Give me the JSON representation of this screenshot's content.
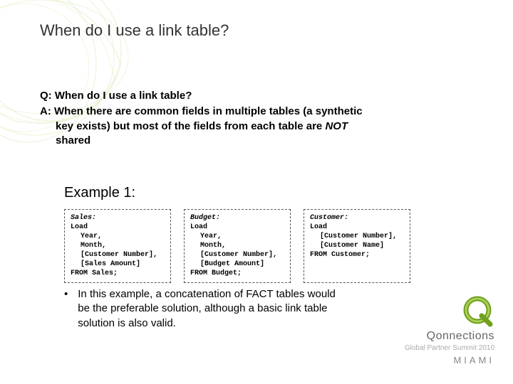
{
  "title": "When do I use a link table?",
  "qa": {
    "q": "Q: When do I use a link table?",
    "a_line1": "A: When there are common fields in multiple tables (a synthetic",
    "a_line2": "key exists) but most of the fields from each table are ",
    "a_not": "NOT",
    "a_line3": "shared"
  },
  "example_label": "Example 1:",
  "code": {
    "sales": {
      "name": "Sales:",
      "l1": "Load",
      "f1": "Year,",
      "f2": "Month,",
      "f3": "[Customer Number],",
      "f4": "[Sales Amount]",
      "from": "FROM Sales;"
    },
    "budget": {
      "name": "Budget:",
      "l1": "Load",
      "f1": "Year,",
      "f2": "Month,",
      "f3": "[Customer Number],",
      "f4": "[Budget Amount]",
      "from": "FROM Budget;"
    },
    "customer": {
      "name": "Customer:",
      "l1": "Load",
      "f1": "[Customer Number],",
      "f2": "[Customer Name]",
      "from": "FROM Customer;"
    }
  },
  "bullet": {
    "dot": "•",
    "text": "In this example, a concatenation of FACT tables would be the preferable solution, although a basic link table solution is also valid."
  },
  "brand": {
    "name": "Qonnections",
    "sub": "Global Partner Summit 2010",
    "city": "MIAMI"
  }
}
